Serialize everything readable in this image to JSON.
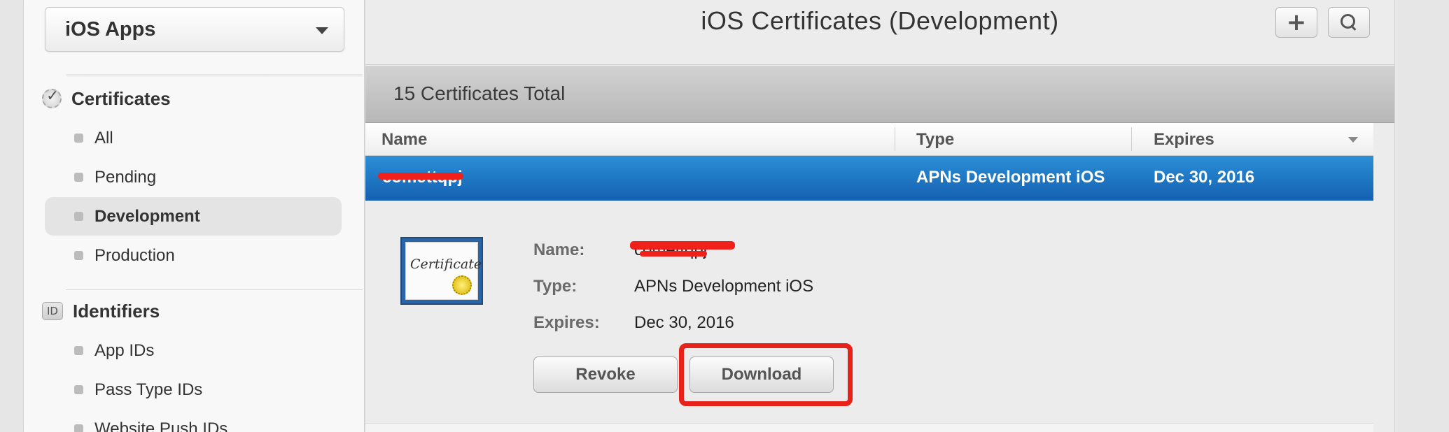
{
  "sidebar": {
    "platform": "iOS Apps",
    "certificates": {
      "heading": "Certificates",
      "items": [
        {
          "label": "All"
        },
        {
          "label": "Pending"
        },
        {
          "label": "Development"
        },
        {
          "label": "Production"
        }
      ]
    },
    "identifiers": {
      "heading": "Identifiers",
      "badge": "ID",
      "items": [
        {
          "label": "App IDs"
        },
        {
          "label": "Pass Type IDs"
        },
        {
          "label": "Website Push IDs"
        }
      ]
    }
  },
  "header": {
    "title": "iOS Certificates (Development)",
    "add_icon": "+",
    "search_icon": "search-icon"
  },
  "list": {
    "total": "15 Certificates Total",
    "columns": {
      "name": "Name",
      "type": "Type",
      "expires": "Expires"
    },
    "selected_row": {
      "name": "comettqpj",
      "type": "APNs Development iOS",
      "expires": "Dec 30, 2016"
    }
  },
  "detail": {
    "cert_word": "Certificate",
    "name_label": "Name:",
    "name_value": "comettqpj",
    "type_label": "Type:",
    "type_value": "APNs Development iOS",
    "expires_label": "Expires:",
    "expires_value": "Dec 30, 2016",
    "revoke": "Revoke",
    "download": "Download"
  },
  "colors": {
    "selection": "#1f76c6",
    "highlight": "#e8221a"
  }
}
